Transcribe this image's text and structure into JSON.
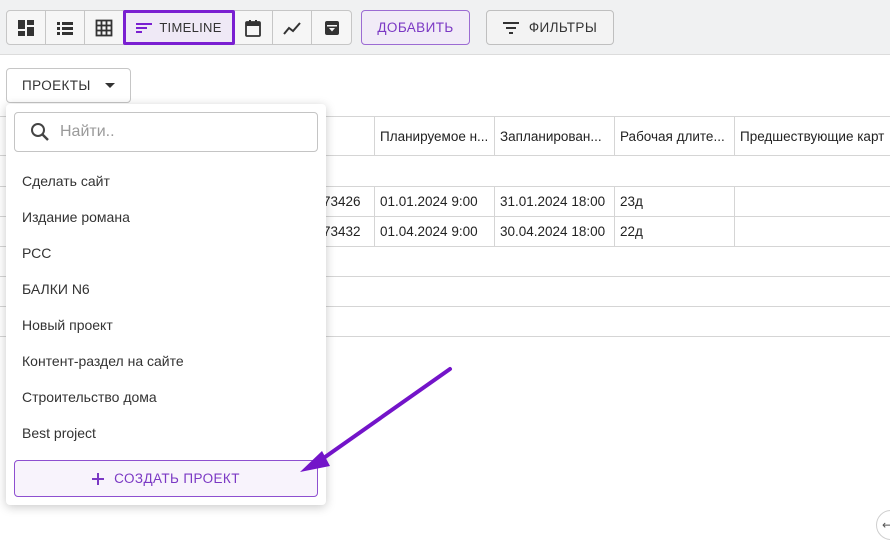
{
  "toolbar": {
    "views": [
      {
        "name": "board-view-icon"
      },
      {
        "name": "list-view-icon"
      },
      {
        "name": "table-view-icon"
      },
      {
        "name": "timeline-view-icon",
        "label": "TIMELINE"
      },
      {
        "name": "calendar-view-icon"
      },
      {
        "name": "chart-view-icon"
      },
      {
        "name": "archive-view-icon"
      }
    ],
    "add_label": "ДОБАВИТЬ",
    "filter_label": "ФИЛЬТРЫ"
  },
  "projects_select": {
    "label": "ПРОЕКТЫ"
  },
  "table": {
    "columns": [
      "Планируемое н...",
      "Запланирован...",
      "Рабочая длите...",
      "Предшествующие карт"
    ],
    "rows": [
      {
        "id": "73426",
        "planned_start": "01.01.2024 9:00",
        "planned_end": "31.01.2024 18:00",
        "duration": "23д",
        "predecessors": ""
      },
      {
        "id": "73432",
        "planned_start": "01.04.2024 9:00",
        "planned_end": "30.04.2024 18:00",
        "duration": "22д",
        "predecessors": ""
      }
    ]
  },
  "dropdown": {
    "search_placeholder": "Найти..",
    "projects": [
      "Сделать сайт",
      "Издание романа",
      "РСС",
      "БАЛКИ N6",
      "Новый проект",
      "Контент-раздел на сайте",
      "Строительство дома",
      "Best project"
    ],
    "create_label": "СОЗДАТЬ ПРОЕКТ"
  },
  "colors": {
    "accent": "#7a1fd1",
    "arrow": "#7314c9"
  }
}
